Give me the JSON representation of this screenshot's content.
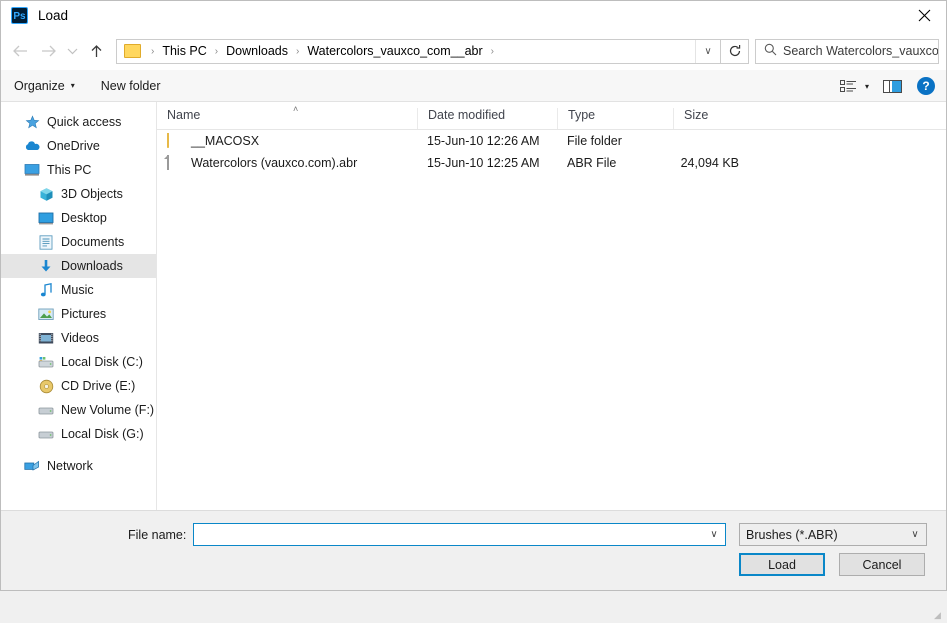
{
  "window": {
    "app_icon_label": "Ps",
    "title": "Load",
    "close_label": "✕"
  },
  "nav": {
    "back_icon": "←",
    "forward_icon": "→",
    "recent_icon": "∨",
    "up_icon": "↑",
    "breadcrumbs": [
      "This PC",
      "Downloads",
      "Watercolors_vauxco_com__abr"
    ],
    "separator": "›",
    "address_dropdown_icon": "∨",
    "refresh_icon": "↻",
    "search_placeholder": "Search Watercolors_vauxco_..."
  },
  "toolbar": {
    "organize_label": "Organize",
    "organize_caret": "▾",
    "new_folder_label": "New folder",
    "view_caret": "▾",
    "help_label": "?"
  },
  "sidebar": {
    "items": [
      {
        "label": "Quick access",
        "icon": "star-icon",
        "indent": false,
        "selected": false
      },
      {
        "label": "OneDrive",
        "icon": "cloud-icon",
        "indent": false,
        "selected": false
      },
      {
        "label": "This PC",
        "icon": "monitor-icon",
        "indent": false,
        "selected": false
      },
      {
        "label": "3D Objects",
        "icon": "cube-icon",
        "indent": true,
        "selected": false
      },
      {
        "label": "Desktop",
        "icon": "desktop-icon",
        "indent": true,
        "selected": false
      },
      {
        "label": "Documents",
        "icon": "documents-icon",
        "indent": true,
        "selected": false
      },
      {
        "label": "Downloads",
        "icon": "download-arrow-icon",
        "indent": true,
        "selected": true
      },
      {
        "label": "Music",
        "icon": "music-note-icon",
        "indent": true,
        "selected": false
      },
      {
        "label": "Pictures",
        "icon": "pictures-icon",
        "indent": true,
        "selected": false
      },
      {
        "label": "Videos",
        "icon": "video-film-icon",
        "indent": true,
        "selected": false
      },
      {
        "label": "Local Disk (C:)",
        "icon": "system-drive-icon",
        "indent": true,
        "selected": false
      },
      {
        "label": "CD Drive (E:)",
        "icon": "cd-drive-icon",
        "indent": true,
        "selected": false
      },
      {
        "label": "New Volume (F:)",
        "icon": "drive-icon",
        "indent": true,
        "selected": false
      },
      {
        "label": "Local Disk (G:)",
        "icon": "drive-icon",
        "indent": true,
        "selected": false
      },
      {
        "label": "Network",
        "icon": "network-icon",
        "indent": false,
        "selected": false
      }
    ]
  },
  "file_list": {
    "columns": [
      "Name",
      "Date modified",
      "Type",
      "Size"
    ],
    "sort_caret": "˄",
    "rows": [
      {
        "name": "__MACOSX",
        "date_modified": "15-Jun-10 12:26 AM",
        "type": "File folder",
        "size": "",
        "icon": "folder-icon"
      },
      {
        "name": "Watercolors (vauxco.com).abr",
        "date_modified": "15-Jun-10 12:25 AM",
        "type": "ABR File",
        "size": "24,094 KB",
        "icon": "file-icon"
      }
    ]
  },
  "footer": {
    "filename_label": "File name:",
    "filename_value": "",
    "filename_placeholder": "",
    "filename_caret": "∨",
    "filter_value": "Brushes (*.ABR)",
    "filter_caret": "∨",
    "load_label": "Load",
    "cancel_label": "Cancel"
  },
  "colors": {
    "accent": "#0a87c8",
    "folder": "#ffd75e",
    "help_blue": "#0a72c4",
    "selection": "#e5e5e5"
  }
}
